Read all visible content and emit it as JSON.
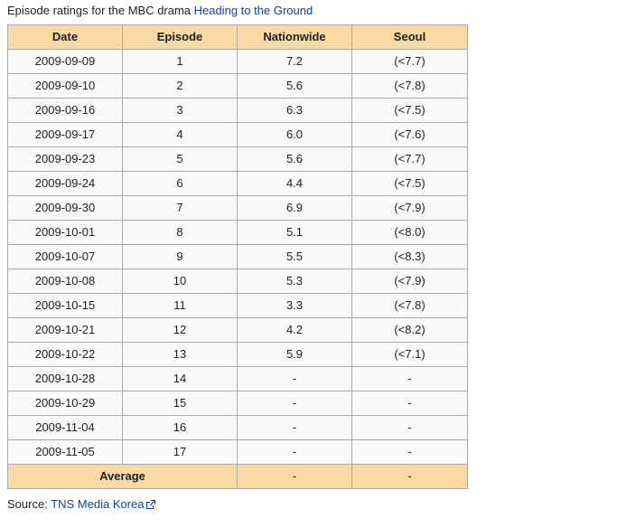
{
  "caption": {
    "prefix": "Episode ratings for the MBC drama ",
    "link_text": "Heading to the Ground"
  },
  "table": {
    "headers": [
      "Date",
      "Episode",
      "Nationwide",
      "Seoul"
    ],
    "rows": [
      [
        "2009-09-09",
        "1",
        "7.2",
        "(<7.7)"
      ],
      [
        "2009-09-10",
        "2",
        "5.6",
        "(<7.8)"
      ],
      [
        "2009-09-16",
        "3",
        "6.3",
        "(<7.5)"
      ],
      [
        "2009-09-17",
        "4",
        "6.0",
        "(<7.6)"
      ],
      [
        "2009-09-23",
        "5",
        "5.6",
        "(<7.7)"
      ],
      [
        "2009-09-24",
        "6",
        "4.4",
        "(<7.5)"
      ],
      [
        "2009-09-30",
        "7",
        "6.9",
        "(<7.9)"
      ],
      [
        "2009-10-01",
        "8",
        "5.1",
        "(<8.0)"
      ],
      [
        "2009-10-07",
        "9",
        "5.5",
        "(<8.3)"
      ],
      [
        "2009-10-08",
        "10",
        "5.3",
        "(<7.9)"
      ],
      [
        "2009-10-15",
        "11",
        "3.3",
        "(<7.8)"
      ],
      [
        "2009-10-21",
        "12",
        "4.2",
        "(<8.2)"
      ],
      [
        "2009-10-22",
        "13",
        "5.9",
        "(<7.1)"
      ],
      [
        "2009-10-28",
        "14",
        "-",
        "-"
      ],
      [
        "2009-10-29",
        "15",
        "-",
        "-"
      ],
      [
        "2009-11-04",
        "16",
        "-",
        "-"
      ],
      [
        "2009-11-05",
        "17",
        "-",
        "-"
      ]
    ],
    "average": {
      "label": "Average",
      "nationwide": "-",
      "seoul": "-"
    }
  },
  "source": {
    "prefix": "Source: ",
    "link_text": "TNS Media Korea",
    "icon": "external-link-icon"
  },
  "colors": {
    "header_bg": "#fbd9a4",
    "cell_bg": "#f9f9f9",
    "border": "#aaaaaa",
    "link": "#0645ad"
  }
}
